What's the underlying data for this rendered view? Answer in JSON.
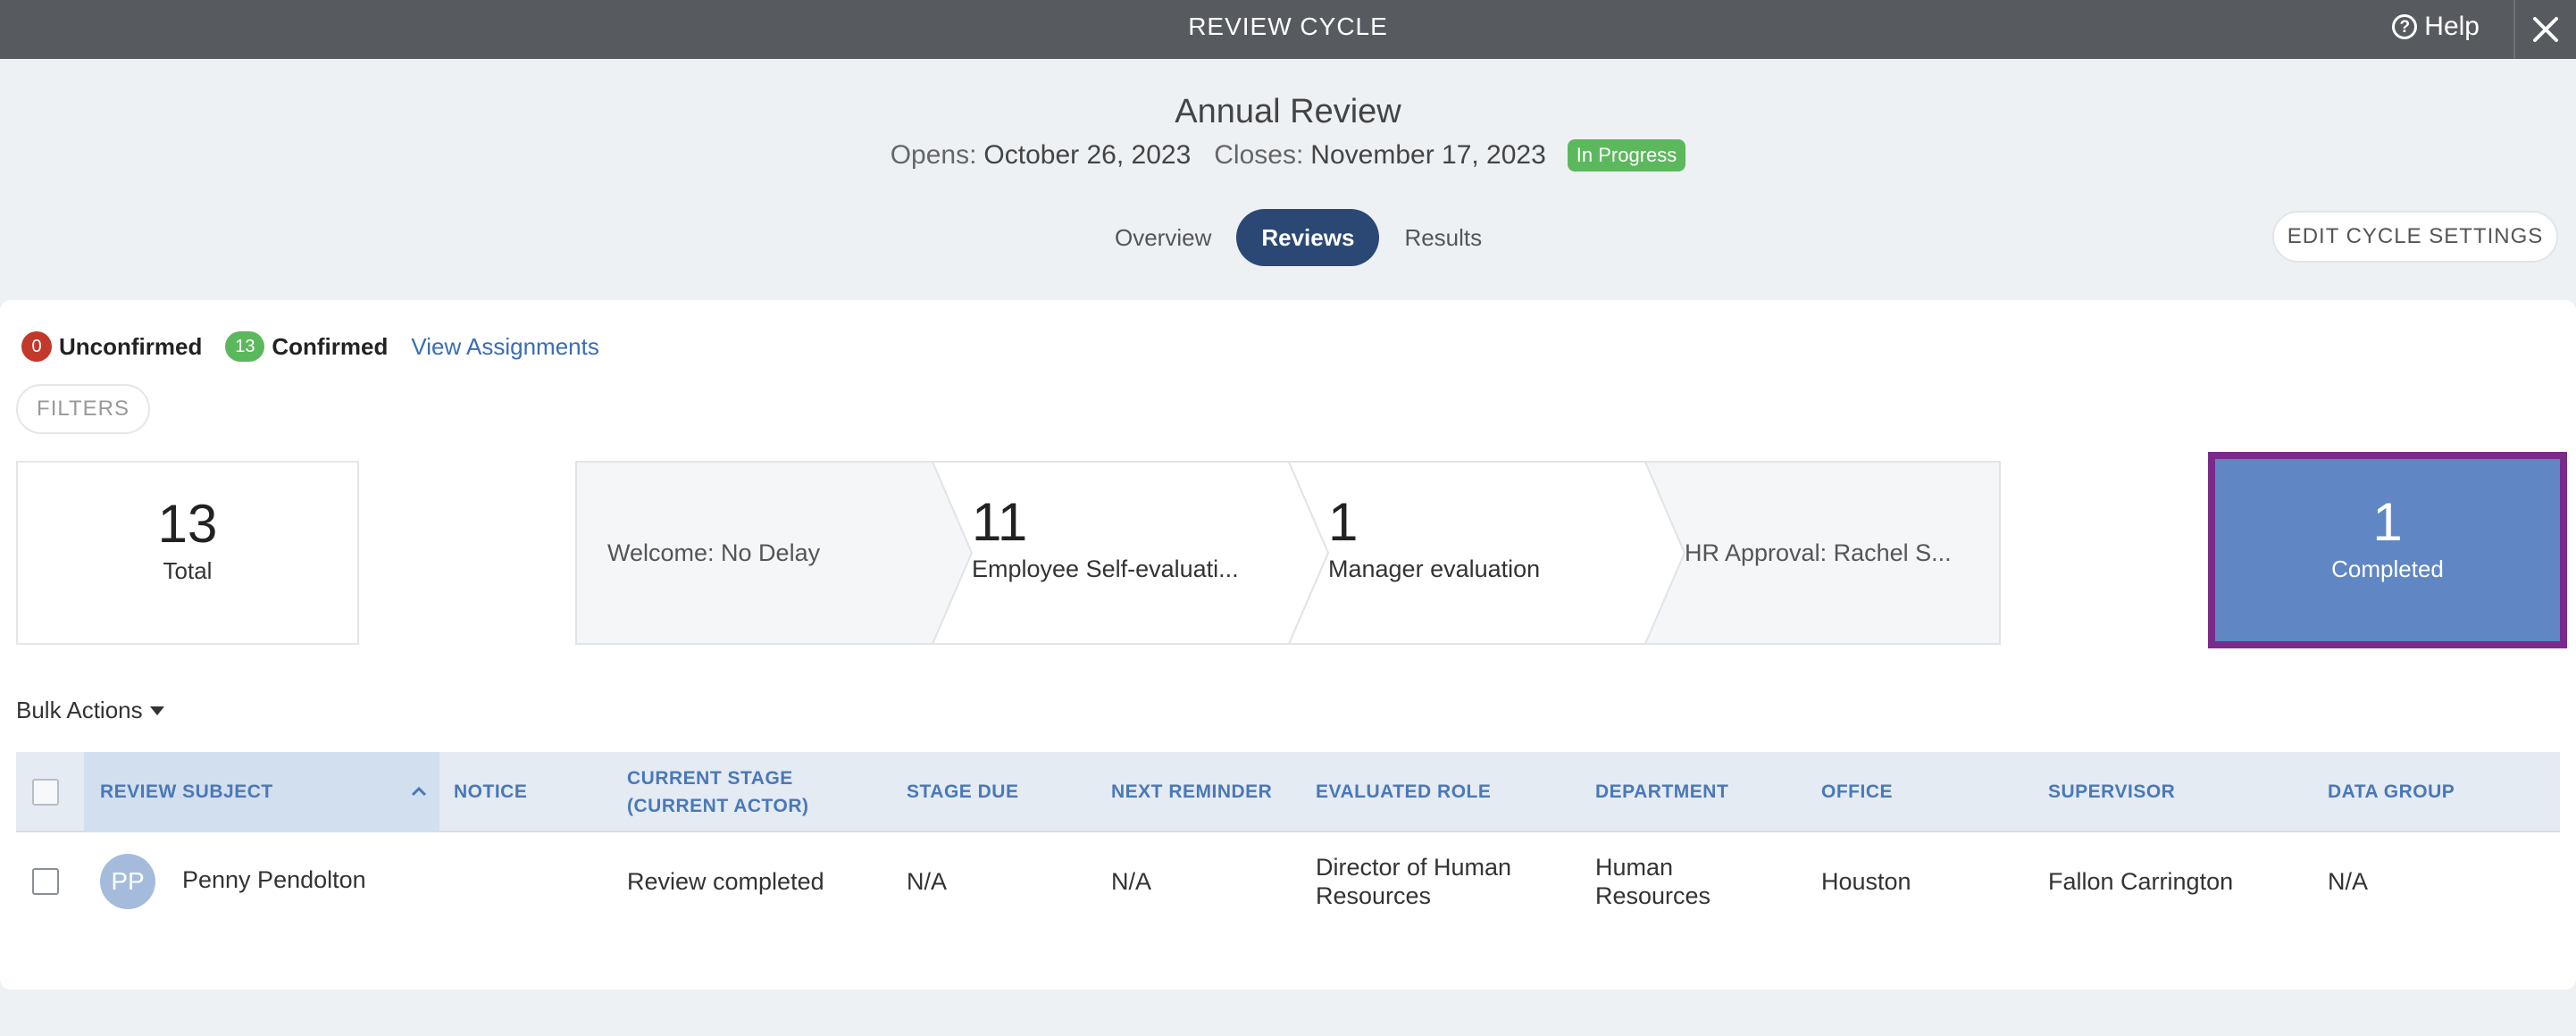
{
  "topbar": {
    "title": "REVIEW CYCLE",
    "help_label": "Help"
  },
  "cycle": {
    "name": "Annual Review",
    "opens_label": "Opens:",
    "opens_date": "October 26, 2023",
    "closes_label": "Closes:",
    "closes_date": "November 17, 2023",
    "status": "In Progress"
  },
  "tabs": [
    {
      "label": "Overview",
      "active": false
    },
    {
      "label": "Reviews",
      "active": true
    },
    {
      "label": "Results",
      "active": false
    }
  ],
  "edit_settings_label": "EDIT CYCLE SETTINGS",
  "confirmation": {
    "unconfirmed_count": "0",
    "unconfirmed_label": "Unconfirmed",
    "confirmed_count": "13",
    "confirmed_label": "Confirmed",
    "view_assignments": "View Assignments"
  },
  "filters_label": "FILTERS",
  "summary": {
    "total_count": "13",
    "total_label": "Total",
    "stages": [
      {
        "label": "Welcome: No Delay",
        "count": ""
      },
      {
        "label": "Employee Self-evaluati...",
        "count": "11"
      },
      {
        "label": "Manager evaluation",
        "count": "1"
      },
      {
        "label": "HR Approval: Rachel S...",
        "count": ""
      }
    ],
    "completed_count": "1",
    "completed_label": "Completed"
  },
  "bulk_actions_label": "Bulk Actions",
  "table": {
    "headers": {
      "review_subject": "REVIEW SUBJECT",
      "notice": "NOTICE",
      "current_stage_1": "CURRENT STAGE",
      "current_stage_2": "(CURRENT ACTOR)",
      "stage_due": "STAGE DUE",
      "next_reminder": "NEXT REMINDER",
      "evaluated_role": "EVALUATED ROLE",
      "department": "DEPARTMENT",
      "office": "OFFICE",
      "supervisor": "SUPERVISOR",
      "data_group": "DATA GROUP"
    },
    "rows": [
      {
        "initials": "PP",
        "name": "Penny Pendolton",
        "notice": "",
        "current_stage": "Review completed",
        "stage_due": "N/A",
        "next_reminder": "N/A",
        "role_1": "Director of Human",
        "role_2": "Resources",
        "dept_1": "Human",
        "dept_2": "Resources",
        "office": "Houston",
        "supervisor": "Fallon Carrington",
        "data_group": "N/A"
      }
    ]
  },
  "colors": {
    "topbar": "#575a5e",
    "tab_active": "#2b4875",
    "badge_green": "#5cb85c",
    "badge_red": "#c0392b",
    "completed_fill": "#6087c3",
    "completed_border": "#7b2a8c",
    "link": "#3a6db5"
  }
}
